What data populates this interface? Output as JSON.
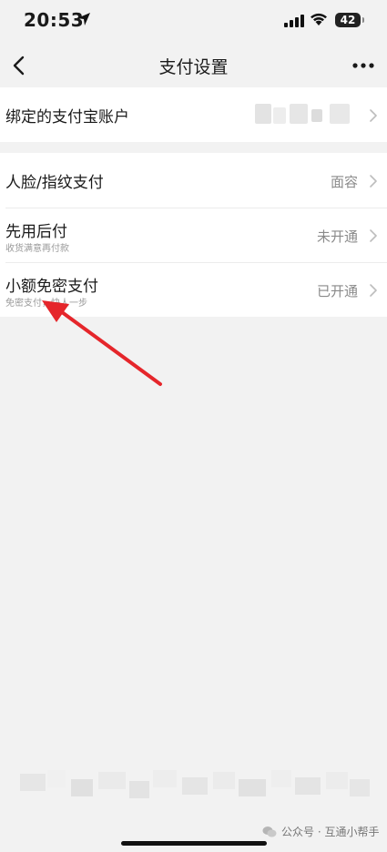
{
  "status_bar": {
    "time": "20:53",
    "battery": "42"
  },
  "nav": {
    "title": "支付设置",
    "more_label": "···"
  },
  "rows": [
    {
      "title": "绑定的支付宝账户",
      "subtitle": "",
      "value": ""
    },
    {
      "title": "人脸/指纹支付",
      "subtitle": "",
      "value": "面容"
    },
    {
      "title": "先用后付",
      "subtitle": "收货满意再付款",
      "value": "未开通"
    },
    {
      "title": "小额免密支付",
      "subtitle": "免密支付，快人一步",
      "value": "已开通"
    }
  ],
  "watermark": {
    "text": "公众号 · 互通小帮手"
  },
  "colors": {
    "background": "#f2f2f2",
    "card": "#ffffff",
    "annotation": "#e5262b"
  }
}
